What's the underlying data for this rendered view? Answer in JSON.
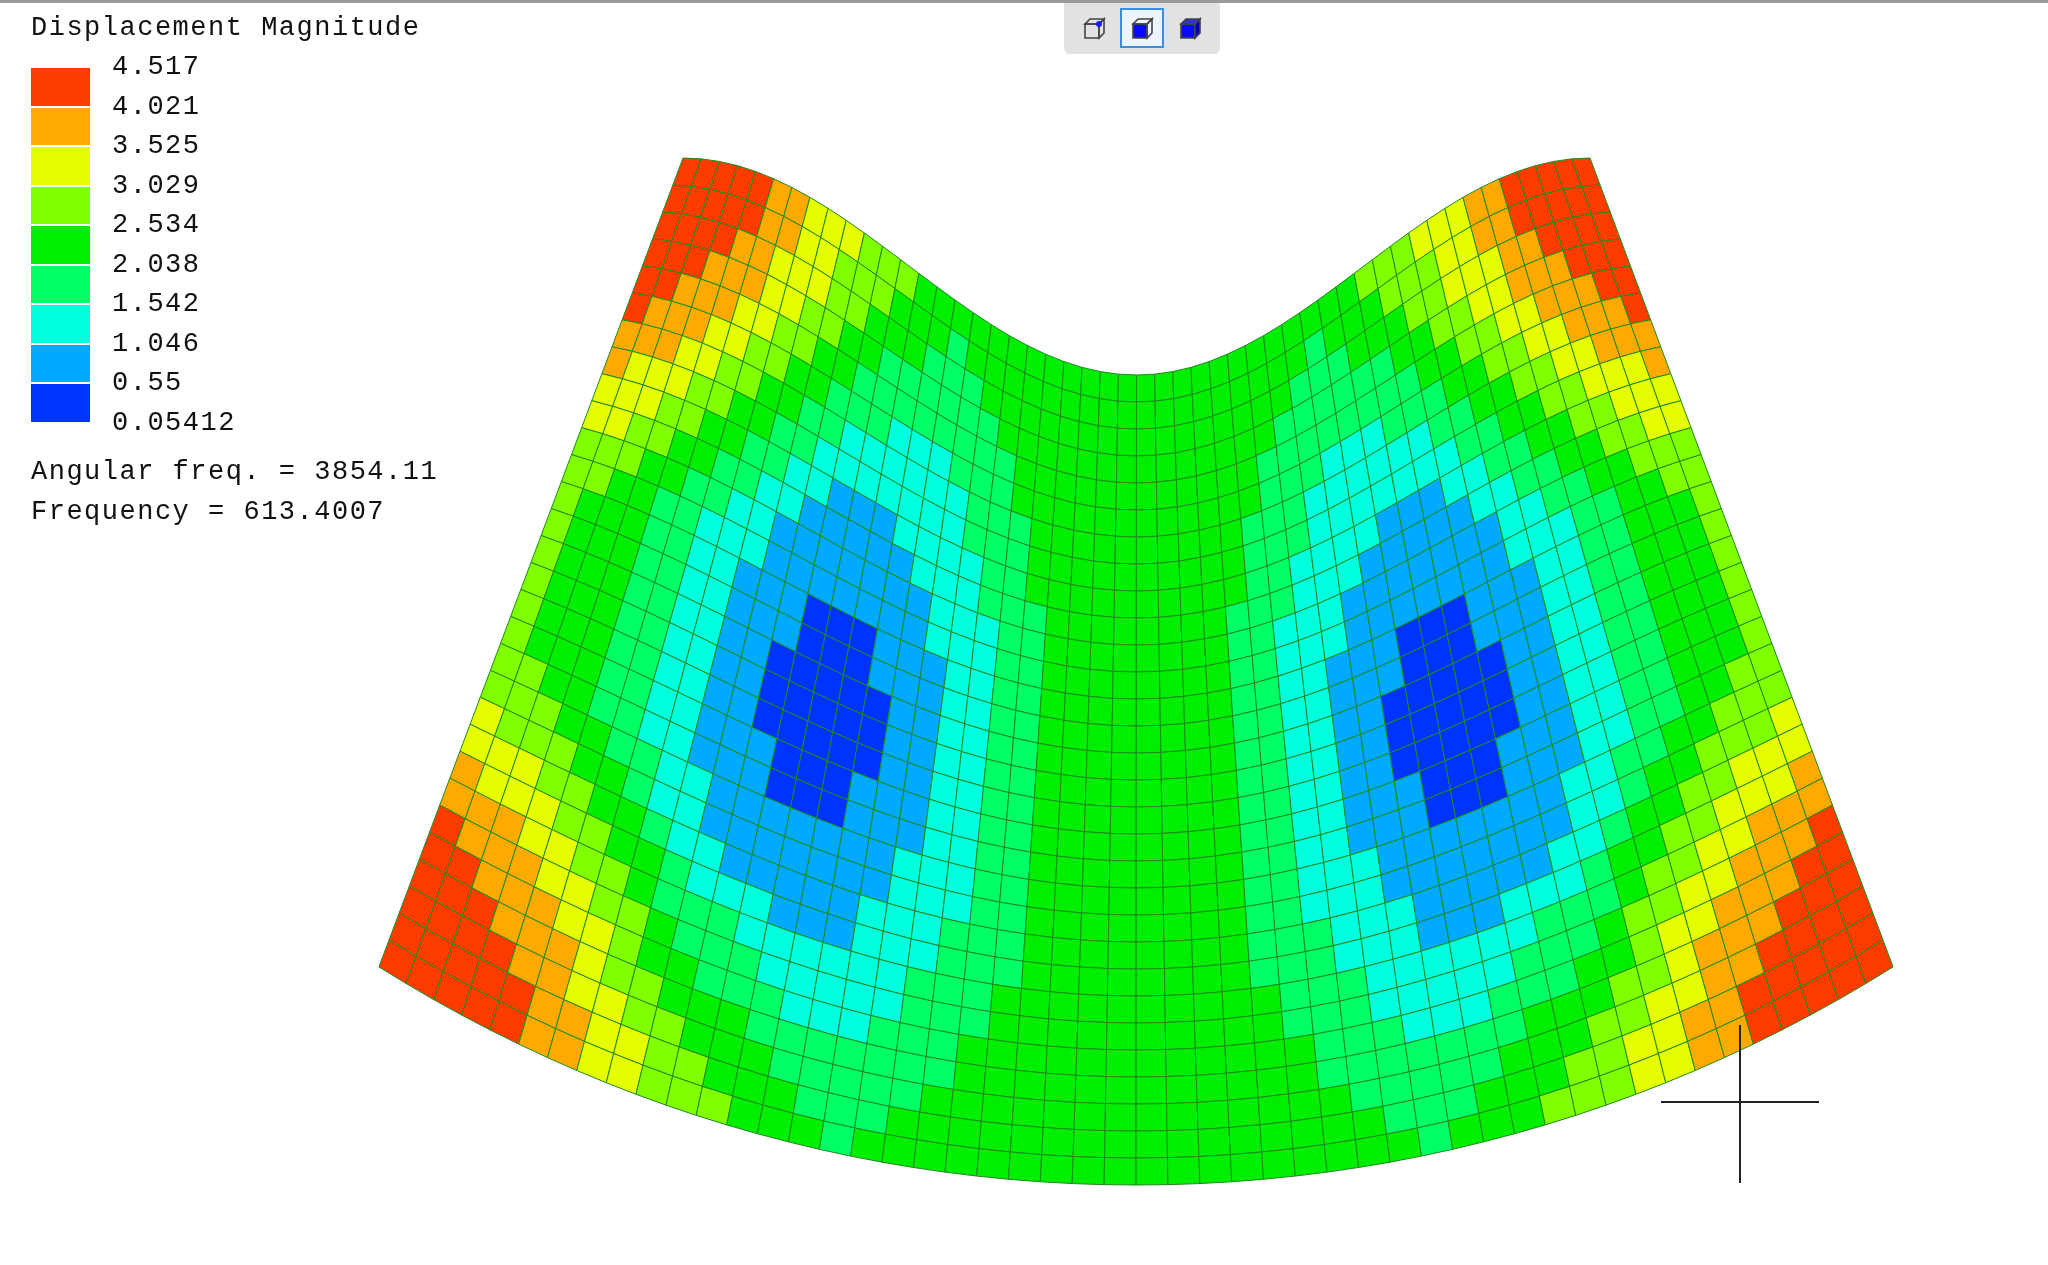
{
  "legend": {
    "title": "Displacement Magnitude",
    "bands": [
      {
        "color": "#ff3c00"
      },
      {
        "color": "#ffaa00"
      },
      {
        "color": "#e6ff00"
      },
      {
        "color": "#7fff00"
      },
      {
        "color": "#00ee00"
      },
      {
        "color": "#00ff66"
      },
      {
        "color": "#00ffdd"
      },
      {
        "color": "#00aaff"
      },
      {
        "color": "#0033ff"
      }
    ],
    "labels": [
      "4.517",
      "4.021",
      "3.525",
      "3.029",
      "2.534",
      "2.038",
      "1.542",
      "1.046",
      "0.55",
      "0.05412"
    ]
  },
  "info": [
    "Angular freq. = 3854.11",
    "Frequency = 613.4007"
  ],
  "toolbar": [
    {
      "kind": "wireframe",
      "selected": false
    },
    {
      "kind": "shaded-edges",
      "selected": true
    },
    {
      "kind": "shaded",
      "selected": false
    }
  ]
}
